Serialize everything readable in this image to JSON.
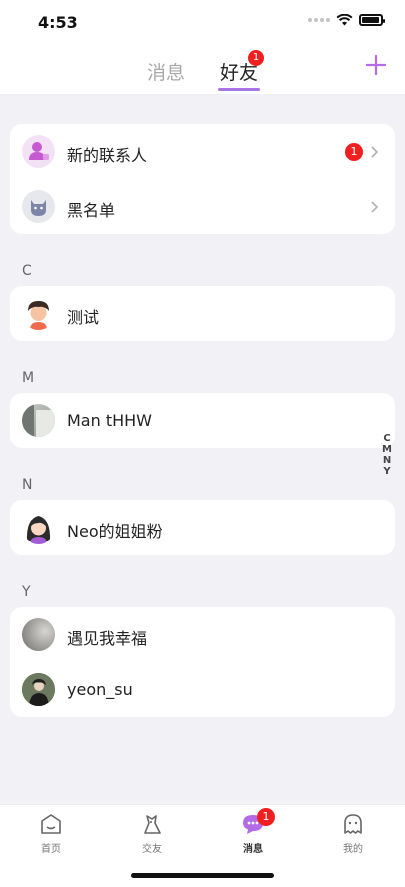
{
  "status": {
    "time": "4:53"
  },
  "header": {
    "tabs": [
      {
        "label": "消息",
        "active": false
      },
      {
        "label": "好友",
        "active": true,
        "badge": "1"
      }
    ],
    "add_icon": "plus-icon",
    "accent": "#a875e6"
  },
  "top_card": [
    {
      "label": "新的联系人",
      "icon": "new-contact-icon",
      "badge": "1"
    },
    {
      "label": "黑名单",
      "icon": "blacklist-icon"
    }
  ],
  "sections": [
    {
      "letter": "C",
      "contacts": [
        {
          "name": "测试"
        }
      ]
    },
    {
      "letter": "M",
      "contacts": [
        {
          "name": "Man tHHW"
        }
      ]
    },
    {
      "letter": "N",
      "contacts": [
        {
          "name": "Neo的姐姐粉"
        }
      ]
    },
    {
      "letter": "Y",
      "contacts": [
        {
          "name": "遇见我幸福"
        },
        {
          "name": "yeon_su"
        }
      ]
    }
  ],
  "index_bar": [
    "C",
    "M",
    "N",
    "Y"
  ],
  "bottom_nav": [
    {
      "label": "首页",
      "icon": "home-icon"
    },
    {
      "label": "交友",
      "icon": "dating-icon"
    },
    {
      "label": "消息",
      "icon": "message-icon",
      "badge": "1",
      "active": true
    },
    {
      "label": "我的",
      "icon": "profile-icon"
    }
  ],
  "colors": {
    "badge": "#f02020",
    "background": "#f1f1f6"
  }
}
